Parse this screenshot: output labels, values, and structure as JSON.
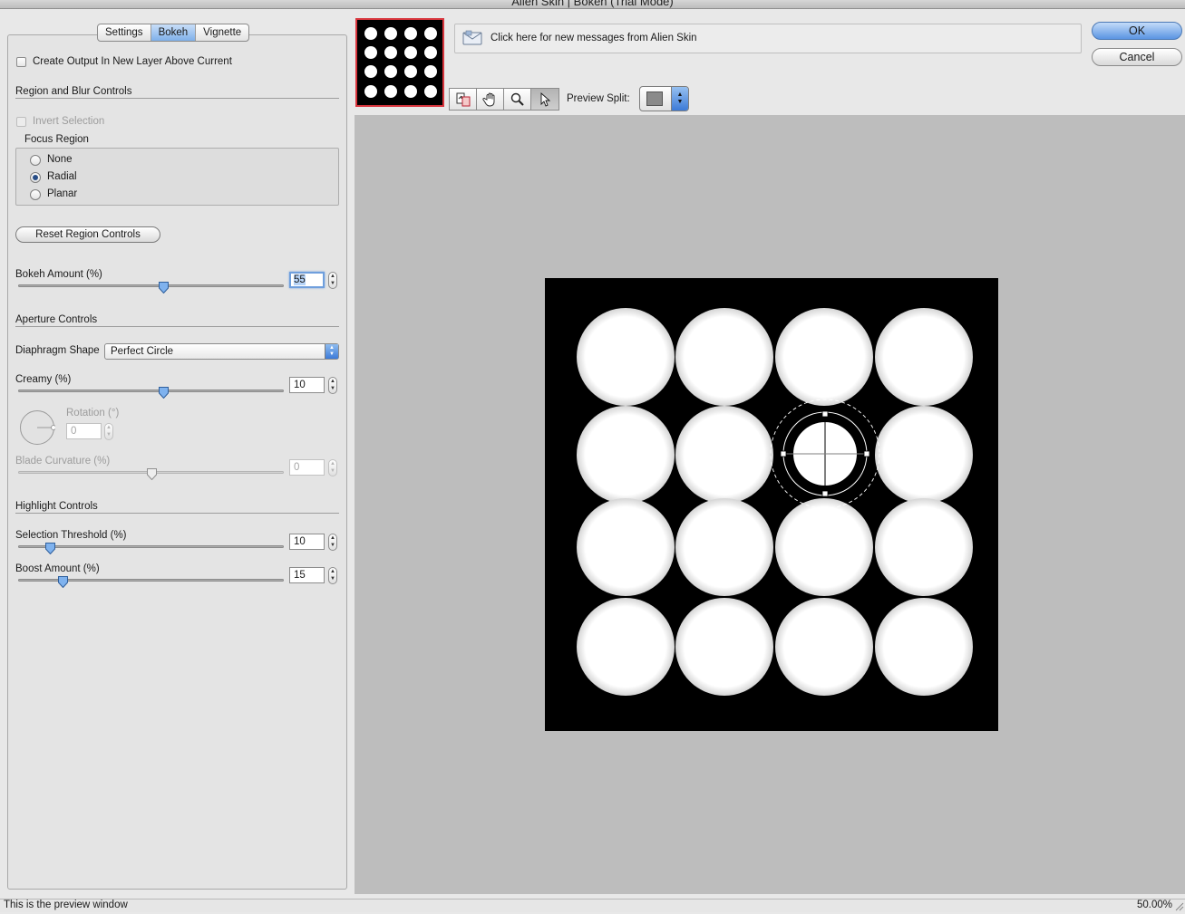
{
  "window": {
    "title": "Alien Skin | Bokeh (Trial Mode)"
  },
  "tabs": [
    {
      "label": "Settings",
      "active": false
    },
    {
      "label": "Bokeh",
      "active": true
    },
    {
      "label": "Vignette",
      "active": false
    }
  ],
  "output": {
    "create_new_layer_label": "Create Output In New Layer Above Current",
    "create_new_layer_checked": false
  },
  "region": {
    "section_title": "Region and Blur Controls",
    "invert_selection_label": "Invert Selection",
    "invert_selection_checked": false,
    "focus_region_title": "Focus Region",
    "options": [
      {
        "label": "None",
        "selected": false
      },
      {
        "label": "Radial",
        "selected": true
      },
      {
        "label": "Planar",
        "selected": false
      }
    ],
    "reset_button_label": "Reset Region Controls"
  },
  "bokeh_amount": {
    "label": "Bokeh Amount (%)",
    "value": "55",
    "fraction": 0.55
  },
  "aperture": {
    "section_title": "Aperture Controls",
    "diaphragm_label": "Diaphragm Shape",
    "diaphragm_value": "Perfect Circle",
    "creamy_label": "Creamy (%)",
    "creamy_value": "10",
    "creamy_fraction": 0.55,
    "rotation_label": "Rotation (°)",
    "rotation_value": "0",
    "blade_label": "Blade Curvature (%)",
    "blade_value": "0",
    "blade_fraction": 0.5
  },
  "highlight": {
    "section_title": "Highlight Controls",
    "threshold_label": "Selection Threshold (%)",
    "threshold_value": "10",
    "threshold_fraction": 0.12,
    "boost_label": "Boost Amount (%)",
    "boost_value": "15",
    "boost_fraction": 0.17
  },
  "messages": {
    "text": "Click here for new messages from Alien Skin"
  },
  "buttons": {
    "ok": "OK",
    "cancel": "Cancel"
  },
  "toolbar": {
    "tools": [
      {
        "name": "compare-tool",
        "active": false
      },
      {
        "name": "hand-tool",
        "active": false
      },
      {
        "name": "zoom-tool",
        "active": false
      },
      {
        "name": "pointer-tool",
        "active": true
      }
    ],
    "preview_split_label": "Preview Split:"
  },
  "status": {
    "text": "This is the preview window",
    "zoom": "50.00%"
  },
  "colors": {
    "accent": "#5a94e2",
    "thumbnail_border": "#d9363e",
    "preview_bg": "#bdbdbd"
  }
}
